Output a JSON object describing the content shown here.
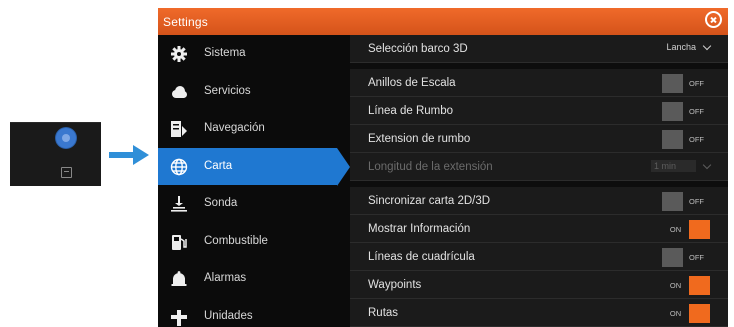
{
  "window": {
    "title": "Settings"
  },
  "sidebar": {
    "items": [
      {
        "label": "Sistema",
        "icon": "gear-icon"
      },
      {
        "label": "Servicios",
        "icon": "cloud-icon"
      },
      {
        "label": "Navegación",
        "icon": "navigation-icon"
      },
      {
        "label": "Carta",
        "icon": "globe-icon",
        "active": true
      },
      {
        "label": "Sonda",
        "icon": "sonar-icon"
      },
      {
        "label": "Combustible",
        "icon": "fuel-pump-icon"
      },
      {
        "label": "Alarmas",
        "icon": "alarm-bell-icon"
      },
      {
        "label": "Unidades",
        "icon": "units-icon"
      }
    ]
  },
  "settings": {
    "boat3d": {
      "label": "Selección barco 3D",
      "value": "Lancha"
    },
    "range_rings": {
      "label": "Anillos de Escala",
      "state": "OFF"
    },
    "heading_line": {
      "label": "Línea de Rumbo",
      "state": "OFF"
    },
    "heading_ext": {
      "label": "Extension de rumbo",
      "state": "OFF"
    },
    "ext_length": {
      "label": "Longitud de la extensión",
      "value": "1 min"
    },
    "sync_2d3d": {
      "label": "Sincronizar carta 2D/3D",
      "state": "OFF"
    },
    "show_info": {
      "label": "Mostrar Información",
      "state": "ON"
    },
    "grid_lines": {
      "label": "Líneas de cuadrícula",
      "state": "OFF"
    },
    "waypoints": {
      "label": "Waypoints",
      "state": "ON"
    },
    "routes": {
      "label": "Rutas",
      "state": "ON"
    }
  },
  "colors": {
    "accent": "#f06a1e",
    "selection": "#1f78d1",
    "arrow": "#2f8fd8"
  }
}
